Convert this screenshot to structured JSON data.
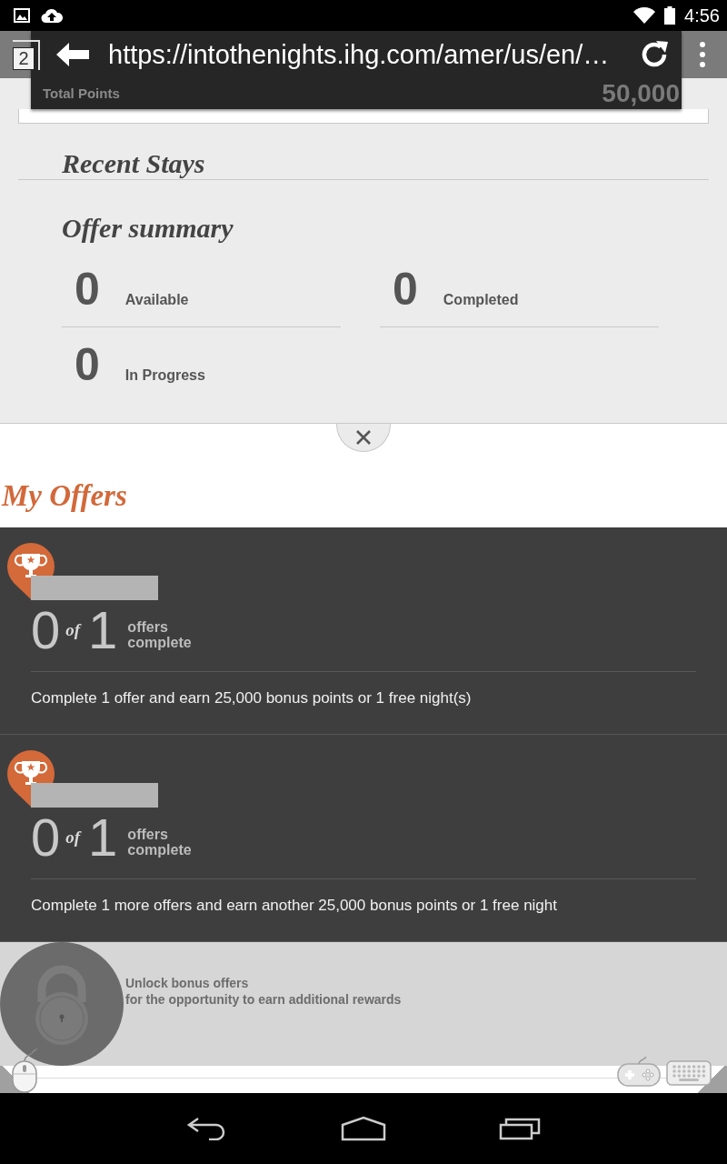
{
  "status_bar": {
    "time": "4:56"
  },
  "browser_toolbar": {
    "tab_count": "2",
    "url": "https://intothenights.ihg.com/amer/us/en/…"
  },
  "points_header": {
    "label": "Total Points",
    "value": "50,000"
  },
  "recent_stays": {
    "title": "Recent Stays"
  },
  "offer_summary": {
    "title": "Offer summary",
    "stats": [
      {
        "count": "0",
        "label": "Available"
      },
      {
        "count": "0",
        "label": "Completed"
      },
      {
        "count": "0",
        "label": "In Progress"
      }
    ]
  },
  "my_offers": {
    "title": "My Offers",
    "offers": [
      {
        "level": 0,
        "done": "0",
        "joiner": "of",
        "total": "1",
        "caption": "offers complete",
        "description": "Complete 1 offer and earn 25,000 bonus points or 1 free night(s)"
      },
      {
        "level": 0,
        "done": "0",
        "joiner": "of",
        "total": "1",
        "caption": "offers complete",
        "description": "Complete 1 more offers and earn another 25,000 bonus points or 1 free night"
      }
    ]
  },
  "unlock": {
    "title": "Unlock bonus offers",
    "subtitle": "for the opportunity to earn additional rewards"
  }
}
